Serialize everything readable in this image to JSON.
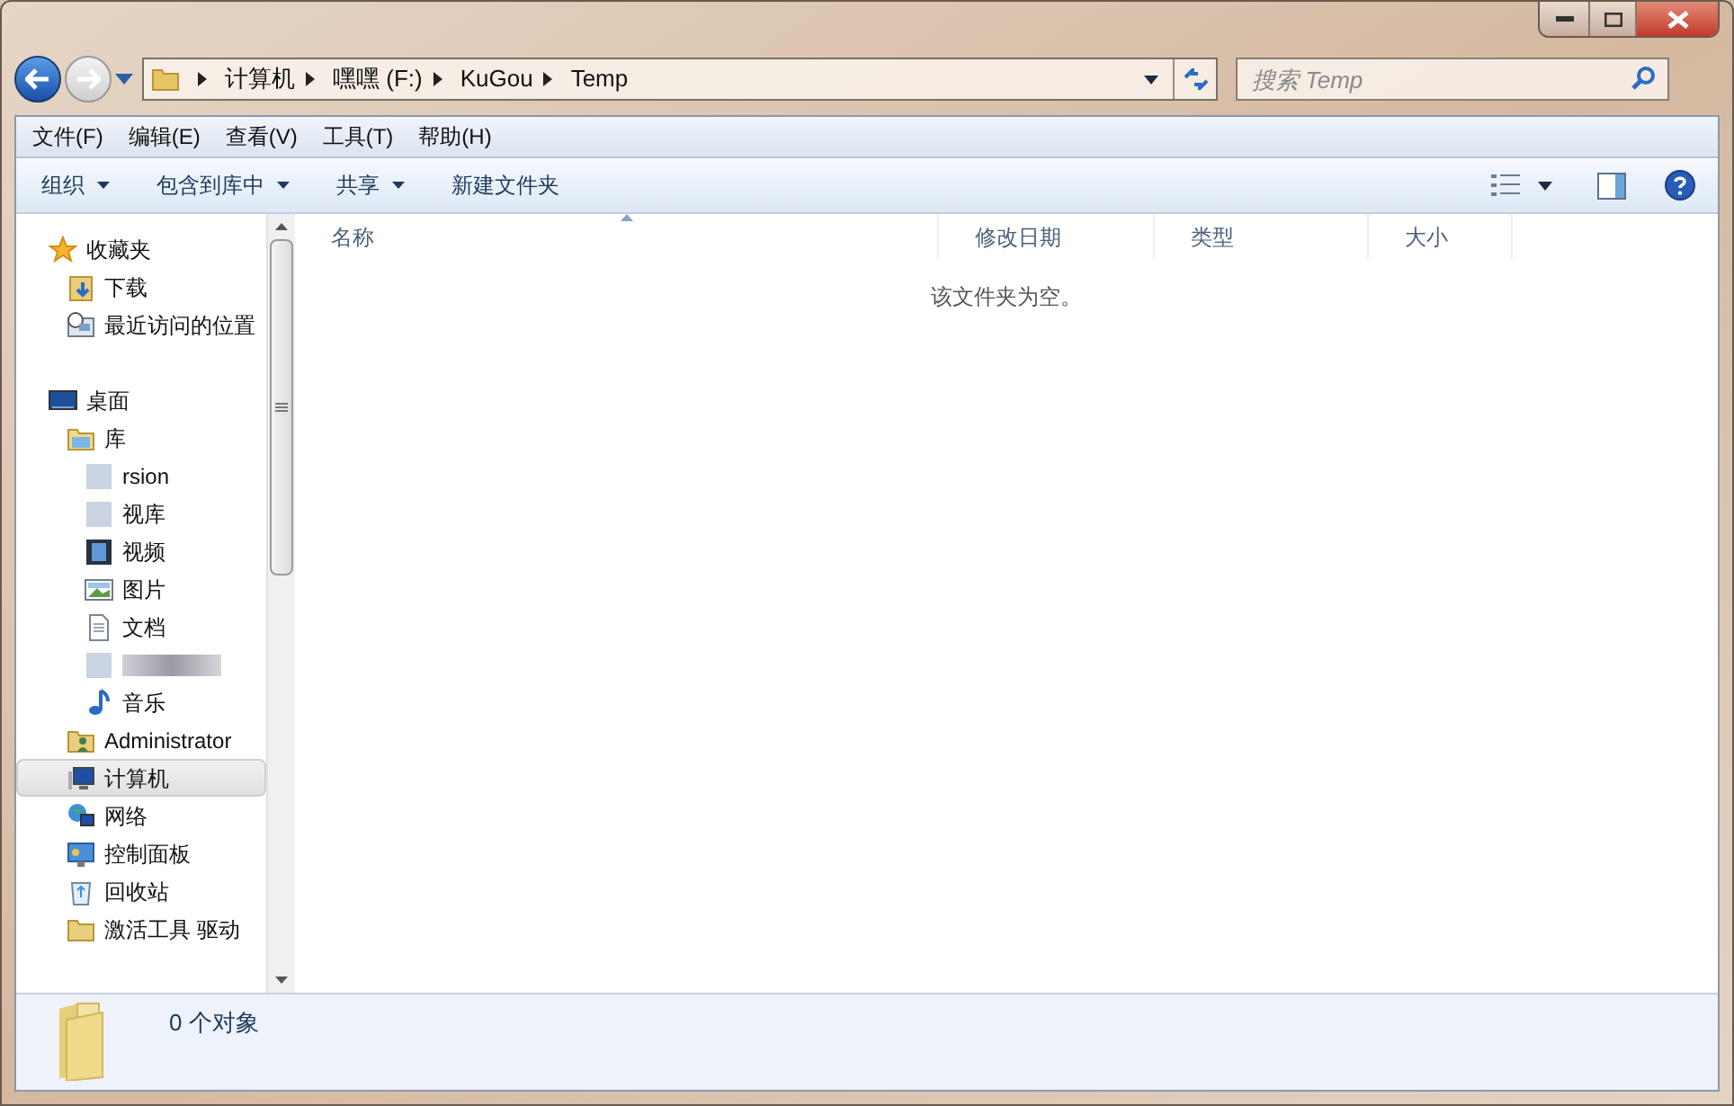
{
  "address_bar": {
    "segments": [
      "计算机",
      "嘿嘿 (F:)",
      "KuGou",
      "Temp"
    ]
  },
  "search": {
    "placeholder": "搜索 Temp"
  },
  "menu_bar": [
    "文件(F)",
    "编辑(E)",
    "查看(V)",
    "工具(T)",
    "帮助(H)"
  ],
  "toolbar": [
    {
      "label": "组织",
      "dropdown": true
    },
    {
      "label": "包含到库中",
      "dropdown": true
    },
    {
      "label": "共享",
      "dropdown": true
    },
    {
      "label": "新建文件夹",
      "dropdown": false
    }
  ],
  "sidebar": {
    "groups": [
      {
        "label": "收藏夹",
        "kind": "star",
        "selected": false,
        "children": [
          {
            "label": "下载",
            "kind": "download",
            "selected": false
          },
          {
            "label": "最近访问的位置",
            "kind": "recent",
            "selected": false
          }
        ]
      },
      {
        "label": "桌面",
        "kind": "desktop",
        "selected": false,
        "children": [
          {
            "label": "库",
            "kind": "library",
            "selected": false,
            "children": [
              {
                "label": "rsion",
                "kind": "blurred",
                "selected": false
              },
              {
                "label": "视库",
                "kind": "blurred",
                "selected": false
              },
              {
                "label": "视频",
                "kind": "video",
                "selected": false
              },
              {
                "label": "图片",
                "kind": "picture",
                "selected": false
              },
              {
                "label": "文档",
                "kind": "document",
                "selected": false
              },
              {
                "kind": "blurred",
                "selected": false
              },
              {
                "label": "音乐",
                "kind": "music",
                "selected": false
              }
            ]
          },
          {
            "label": "Administrator",
            "kind": "user",
            "selected": false
          },
          {
            "label": "计算机",
            "kind": "computer",
            "selected": true
          },
          {
            "label": "网络",
            "kind": "network",
            "selected": false
          },
          {
            "label": "控制面板",
            "kind": "control",
            "selected": false
          },
          {
            "label": "回收站",
            "kind": "recycle",
            "selected": false
          },
          {
            "label": "激活工具 驱动",
            "kind": "folder",
            "selected": false
          }
        ]
      }
    ]
  },
  "table": {
    "columns": [
      "名称",
      "修改日期",
      "类型",
      "大小"
    ],
    "empty_message": "该文件夹为空。"
  },
  "status_bar": {
    "text": "0 个对象"
  }
}
